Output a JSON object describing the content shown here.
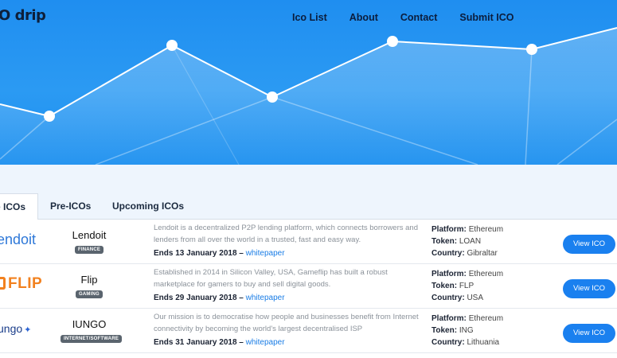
{
  "header": {
    "logo_text": "O drip",
    "nav": [
      "Ico List",
      "About",
      "Contact",
      "Submit ICO"
    ]
  },
  "tabs": [
    "e ICOs",
    "Pre-ICOs",
    "Upcoming ICOs"
  ],
  "labels": {
    "platform": "Platform:",
    "token": "Token:",
    "country": "Country:",
    "ends_prefix": "Ends",
    "separator": "–"
  },
  "icos": [
    {
      "brand": "endoit",
      "brand_color": "#2e78d8",
      "name": "Lendoit",
      "category": "FINANCE",
      "description": "Lendoit is a decentralized P2P lending platform, which connects borrowers and lenders from all over the world in a trusted, fast and easy way.",
      "ends": "13 January 2018",
      "link": "whitepaper",
      "platform": "Ethereum",
      "token": "LOAN",
      "country": "Gibraltar",
      "button": "View ICO"
    },
    {
      "brand": "FLIP",
      "brand_color": "#f2811f",
      "name": "Flip",
      "category": "GAMING",
      "description": "Established in 2014 in Silicon Valley, USA, Gameflip has built a robust marketplace for gamers to buy and sell digital goods.",
      "ends": "29 January 2018",
      "link": "whitepaper",
      "platform": "Ethereum",
      "token": "FLP",
      "country": "USA",
      "button": "View ICO"
    },
    {
      "brand": "ungo",
      "brand_color": "#1a3d8a",
      "name": "IUNGO",
      "category": "INTERNET/SOFTWARE",
      "description": "Our mission is to democratise how people and businesses benefit from Internet connectivity by becoming the world's largest decentralised ISP",
      "ends": "31 January 2018",
      "link": "whitepaper",
      "platform": "Ethereum",
      "token": "ING",
      "country": "Lithuania",
      "button": "View ICO"
    }
  ]
}
